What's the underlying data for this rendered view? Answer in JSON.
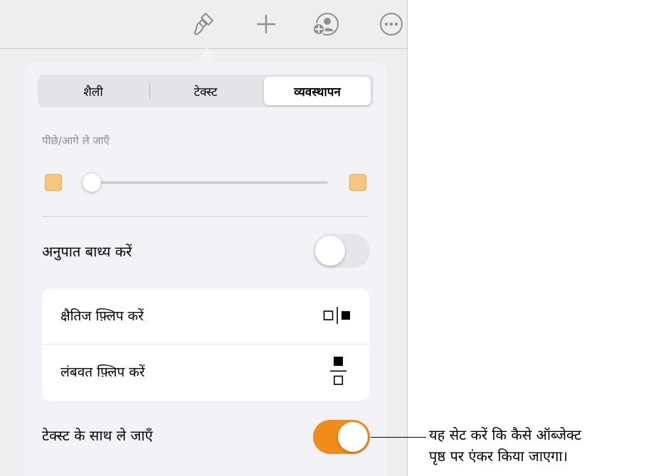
{
  "toolbar": {
    "icons": [
      "paintbrush-icon",
      "plus-icon",
      "add-person-icon",
      "more-icon"
    ]
  },
  "tabs": [
    {
      "label": "शैली",
      "active": false
    },
    {
      "label": "टेक्स्ट",
      "active": false
    },
    {
      "label": "व्यवस्थापन",
      "active": true
    }
  ],
  "arrange": {
    "section_label": "पीछे/आगे ले जाएँ",
    "slider_value": 0,
    "constrain_label": "अनुपात बाध्य करें",
    "constrain_on": false,
    "flip_horizontal_label": "क्षैतिज फ़्लिप करें",
    "flip_vertical_label": "लंबवत फ़्लिप करें",
    "move_with_text_label": "टेक्स्ट के साथ ले जाएँ",
    "move_with_text_on": true
  },
  "colors": {
    "accent": "#ef8c1b",
    "slider_square": "#f5c77e"
  },
  "callout": {
    "line1": "यह सेट करें कि कैसे ऑब्जेक्ट",
    "line2": "पृष्ठ पर एंकर किया जाएगा।"
  }
}
